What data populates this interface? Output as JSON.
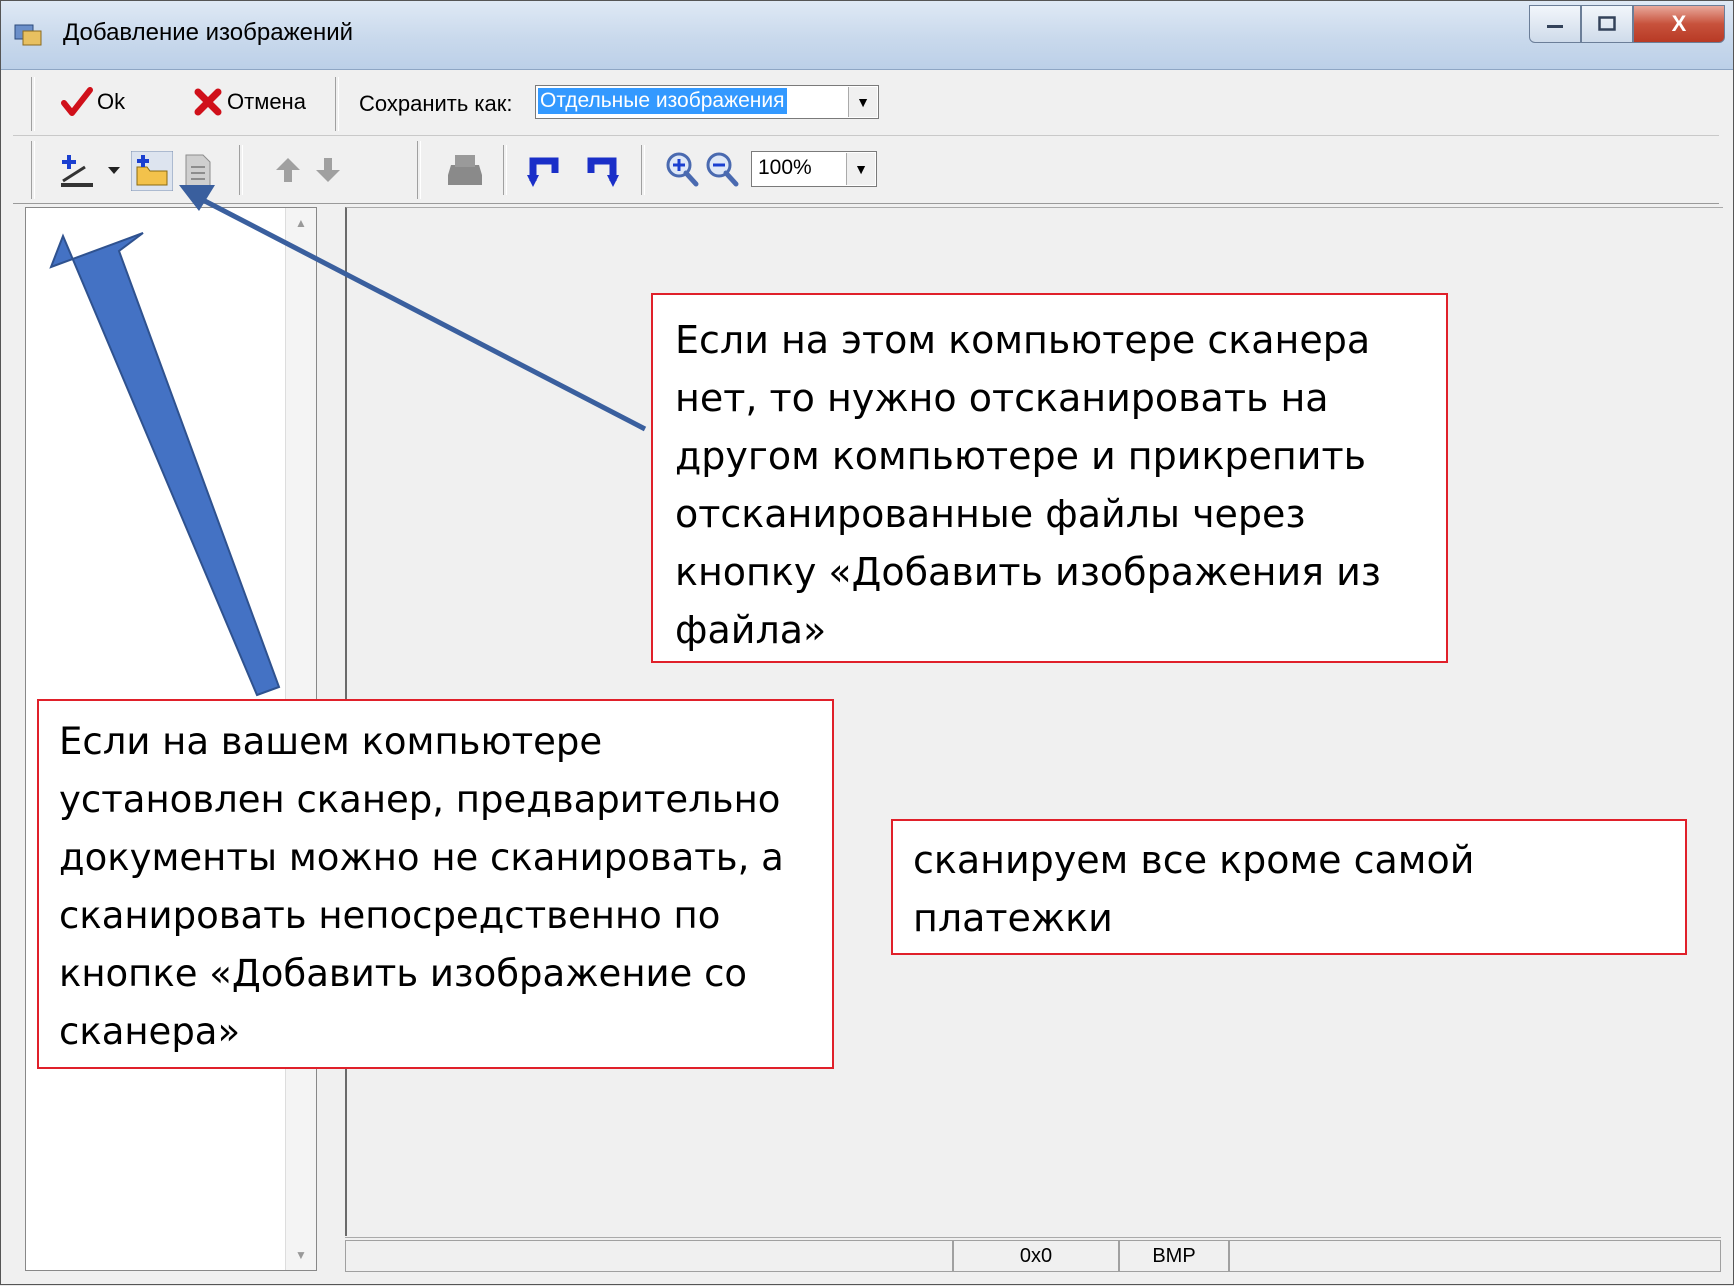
{
  "window": {
    "title": "Добавление изображений",
    "controls": {
      "minimize": "–",
      "maximize": "□",
      "close": "X"
    }
  },
  "toolbar1": {
    "ok_label": "Ok",
    "cancel_label": "Отмена",
    "save_as_label": "Сохранить как:",
    "save_as_value": "Отдельные изображения"
  },
  "toolbar2": {
    "icons": [
      "scan-add-icon",
      "dropdown-arrow-icon",
      "add-from-file-icon",
      "document-icon",
      "move-up-icon",
      "move-down-icon",
      "print-icon",
      "rotate-left-icon",
      "rotate-right-icon",
      "zoom-in-icon",
      "zoom-out-icon"
    ],
    "zoom_value": "100%"
  },
  "statusbar": {
    "size": "0x0",
    "format": "BMP"
  },
  "callouts": {
    "file_note": "Если на этом компьютере сканера нет, то нужно отсканировать на другом компьютере и прикрепить отсканированные файлы через кнопку «Добавить изображения из файла»",
    "scanner_note": "Если на вашем компьютере установлен сканер, предварительно документы можно не сканировать, а сканировать непосредственно по кнопке «Добавить изображение со сканера»",
    "scan_all_note": "сканируем все кроме самой платежки"
  },
  "colors": {
    "callout_border": "#e0202a",
    "arrow": "#4472c4",
    "selection": "#3399ff"
  }
}
